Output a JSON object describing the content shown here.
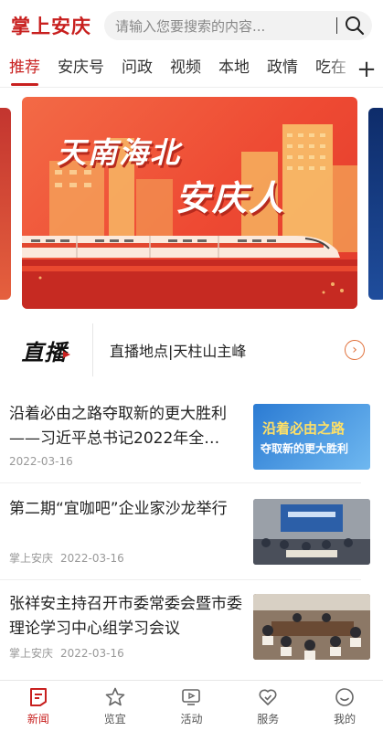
{
  "header": {
    "logo": "掌上安庆",
    "search_placeholder": "请输入您要搜索的内容..."
  },
  "tabs": [
    {
      "label": "推荐",
      "active": true
    },
    {
      "label": "安庆号"
    },
    {
      "label": "问政"
    },
    {
      "label": "视频"
    },
    {
      "label": "本地"
    },
    {
      "label": "政情"
    },
    {
      "label": "吃在"
    }
  ],
  "banner": {
    "line1": "天南海北",
    "line2": "安庆人"
  },
  "live": {
    "logo": "直播",
    "text": "直播地点|天柱山主峰"
  },
  "news": [
    {
      "title": "沿着必由之路夺取新的更大胜利——习近平总书记2022年全…",
      "source": "",
      "date": "2022-03-16",
      "thumb_text1": "沿着必由之路",
      "thumb_text2": "夺取新的更大胜利"
    },
    {
      "title": "第二期“宜咖吧”企业家沙龙举行",
      "source": "掌上安庆",
      "date": "2022-03-16"
    },
    {
      "title": "张祥安主持召开市委常委会暨市委理论学习中心组学习会议",
      "source": "掌上安庆",
      "date": "2022-03-16"
    }
  ],
  "bottom_nav": [
    {
      "label": "新闻",
      "icon": "news-icon",
      "active": true
    },
    {
      "label": "览宜",
      "icon": "star-icon"
    },
    {
      "label": "活动",
      "icon": "tv-icon"
    },
    {
      "label": "服务",
      "icon": "heart-check-icon"
    },
    {
      "label": "我的",
      "icon": "smile-icon"
    }
  ],
  "colors": {
    "accent": "#c8201f",
    "banner": "#ee4a33"
  }
}
